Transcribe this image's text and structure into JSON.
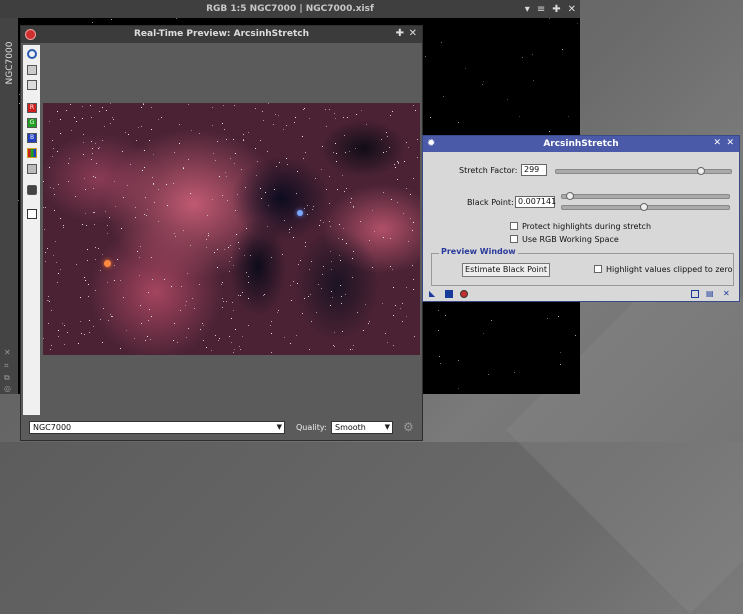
{
  "main_window": {
    "title": "RGB 1:5 NGC7000 | NGC7000.xisf",
    "side_tab": "NGC7000",
    "icons": [
      "pin-icon",
      "shade-icon",
      "maximize-icon",
      "close-icon"
    ]
  },
  "preview_window": {
    "title": "Real-Time Preview: ArcsinhStretch",
    "view_selector": "NGC7000",
    "quality_label": "Quality:",
    "quality_value": "Smooth",
    "toolbar_icons": [
      "zoom-fit-icon",
      "zoom-in-icon",
      "zoom-out-icon",
      "red-channel-icon",
      "green-channel-icon",
      "blue-channel-icon",
      "rgb-channel-icon",
      "luminance-icon",
      "snapshot-icon",
      "new-window-icon"
    ],
    "channel_letters": {
      "r": "R",
      "g": "G",
      "b": "B"
    }
  },
  "dialog": {
    "title": "ArcsinhStretch",
    "stretch_label": "Stretch Factor:",
    "stretch_value": "299",
    "black_point_label": "Black Point:",
    "black_point_value": "0.007141",
    "protect_label": "Protect highlights during stretch",
    "protect_checked": false,
    "rgb_ws_label": "Use RGB Working Space",
    "rgb_ws_checked": false,
    "preview_group_title": "Preview Window",
    "estimate_button": "Estimate Black Point",
    "highlight_label": "Highlight values clipped to zero",
    "highlight_checked": false
  },
  "colors": {
    "dialog_title_bar": "#4a5aa8",
    "group_title": "#2a3a9a"
  }
}
